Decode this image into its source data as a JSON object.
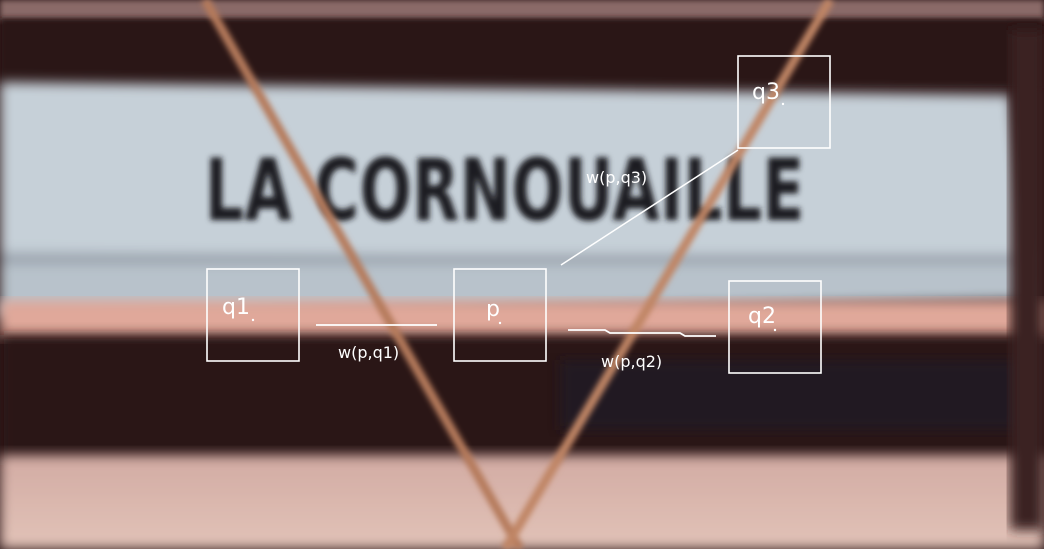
{
  "sign": {
    "text": "LA CORNOUAILLE"
  },
  "diagram": {
    "center_patch": {
      "label": "p"
    },
    "neighbor_patches": [
      {
        "id": "q1",
        "label": "q1"
      },
      {
        "id": "q2",
        "label": "q2"
      },
      {
        "id": "q3",
        "label": "q3"
      }
    ],
    "edge_weights": [
      {
        "from": "p",
        "to": "q1",
        "label": "w(p,q1)"
      },
      {
        "from": "p",
        "to": "q2",
        "label": "w(p,q2)"
      },
      {
        "from": "p",
        "to": "q3",
        "label": "w(p,q3)"
      }
    ],
    "colors": {
      "annotation": "#ffffff",
      "sign_face": "#c9d3da",
      "sign_frame": "#2b1416",
      "sign_text": "#1e1c20",
      "pole": "#b57a5c"
    }
  }
}
